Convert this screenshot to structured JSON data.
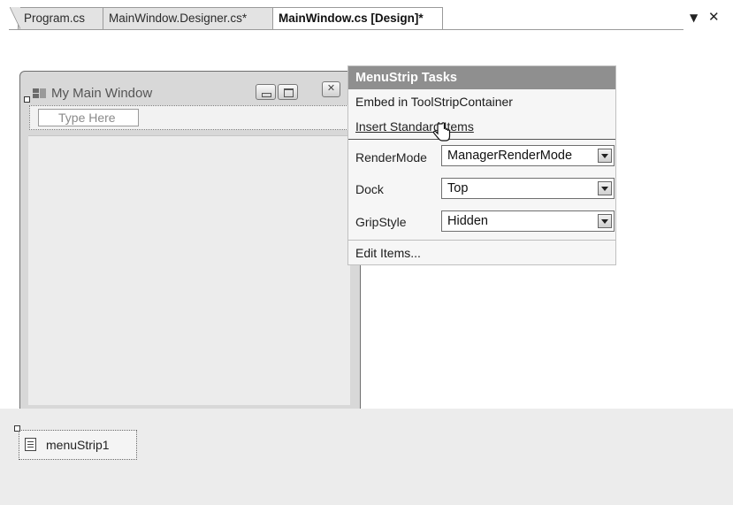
{
  "tabs": [
    {
      "label": "Program.cs"
    },
    {
      "label": "MainWindow.Designer.cs*"
    },
    {
      "label": "MainWindow.cs [Design]*"
    }
  ],
  "tab_controls": {
    "dropdown_icon": "▼",
    "close_icon": "✕"
  },
  "form": {
    "title": "My Main Window",
    "menustrip_placeholder": "Type Here",
    "smarttag_glyph": "◂"
  },
  "tasks_panel": {
    "header": "MenuStrip Tasks",
    "actions": {
      "embed": "Embed in ToolStripContainer",
      "insert": "Insert Standard Items",
      "edit": "Edit Items..."
    },
    "properties": [
      {
        "label": "RenderMode",
        "value": "ManagerRenderMode"
      },
      {
        "label": "Dock",
        "value": "Top"
      },
      {
        "label": "GripStyle",
        "value": "Hidden"
      }
    ]
  },
  "tray": {
    "component": "menuStrip1"
  },
  "colors": {
    "panel_header_bg": "#8f8f8f",
    "tray_bg": "#ececec",
    "form_bg": "#d8d8d8"
  }
}
